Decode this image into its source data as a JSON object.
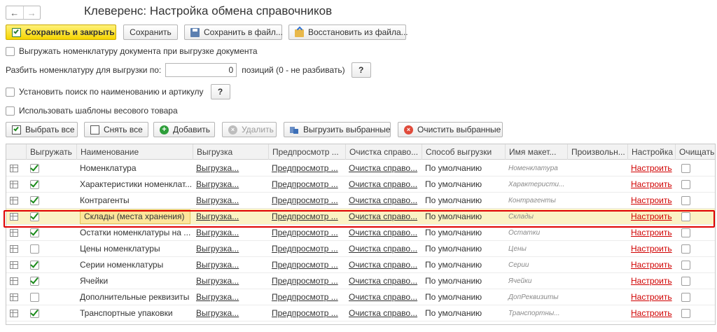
{
  "window": {
    "title": "Клеверенс: Настройка обмена справочников",
    "back_icon": "←",
    "forward_icon": "→"
  },
  "toolbar": {
    "save_close": "Сохранить и закрыть",
    "save": "Сохранить",
    "save_file": "Сохранить в файл...",
    "restore_file": "Восстановить из файла..."
  },
  "options": {
    "export_nomenclature": "Выгружать номенклатуру документа при выгрузке документа",
    "split_label": "Разбить номенклатуру для выгрузки по:",
    "split_value": "0",
    "split_suffix": "позиций (0 - не разбивать)",
    "help": "?",
    "search_setting": "Установить поиск по наименованию и артикулу",
    "weight_templates": "Использовать шаблоны весового товара"
  },
  "actions": {
    "select_all": "Выбрать все",
    "unselect_all": "Снять все",
    "add": "Добавить",
    "delete": "Удалить",
    "export_selected": "Выгрузить выбранные",
    "clear_selected": "Очистить выбранные"
  },
  "table": {
    "headers": [
      "Выгружать",
      "Наименование",
      "Выгрузка",
      "Предпросмотр ...",
      "Очистка справо...",
      "Способ выгрузки",
      "Имя макет...",
      "Произвольн...",
      "Настройка",
      "Очищать"
    ],
    "rows": [
      {
        "checked": true,
        "name": "Номенклатура",
        "export": "Выгрузка...",
        "preview": "Предпросмотр ...",
        "clear": "Очистка справо...",
        "method": "По умолчанию",
        "template": "Номенклатура",
        "setting": "Настроить"
      },
      {
        "checked": true,
        "name": "Характеристики номенклат...",
        "export": "Выгрузка...",
        "preview": "Предпросмотр ...",
        "clear": "Очистка справо...",
        "method": "По умолчанию",
        "template": "Характеристи...",
        "setting": "Настроить"
      },
      {
        "checked": true,
        "name": "Контрагенты",
        "export": "Выгрузка...",
        "preview": "Предпросмотр ...",
        "clear": "Очистка справо...",
        "method": "По умолчанию",
        "template": "Контрагенты",
        "setting": "Настроить"
      },
      {
        "checked": true,
        "name": "Склады (места хранения)",
        "export": "Выгрузка...",
        "preview": "Предпросмотр ...",
        "clear": "Очистка справо...",
        "method": "По умолчанию",
        "template": "Склады",
        "setting": "Настроить"
      },
      {
        "checked": true,
        "name": "Остатки номенклатуры на ...",
        "export": "Выгрузка...",
        "preview": "Предпросмотр ...",
        "clear": "Очистка справо...",
        "method": "По умолчанию",
        "template": "Остатки",
        "setting": "Настроить"
      },
      {
        "checked": false,
        "name": "Цены номенклатуры",
        "export": "Выгрузка...",
        "preview": "Предпросмотр ...",
        "clear": "Очистка справо...",
        "method": "По умолчанию",
        "template": "Цены",
        "setting": "Настроить"
      },
      {
        "checked": true,
        "name": "Серии номенклатуры",
        "export": "Выгрузка...",
        "preview": "Предпросмотр ...",
        "clear": "Очистка справо...",
        "method": "По умолчанию",
        "template": "Серии",
        "setting": "Настроить"
      },
      {
        "checked": true,
        "name": "Ячейки",
        "export": "Выгрузка...",
        "preview": "Предпросмотр ...",
        "clear": "Очистка справо...",
        "method": "По умолчанию",
        "template": "Ячейки",
        "setting": "Настроить"
      },
      {
        "checked": false,
        "name": "Дополнительные реквизиты",
        "export": "Выгрузка...",
        "preview": "Предпросмотр ...",
        "clear": "Очистка справо...",
        "method": "По умолчанию",
        "template": "ДопРеквизиты",
        "setting": "Настроить"
      },
      {
        "checked": true,
        "name": "Транспортные упаковки",
        "export": "Выгрузка...",
        "preview": "Предпросмотр ...",
        "clear": "Очистка справо...",
        "method": "По умолчанию",
        "template": "Транспортны...",
        "setting": "Настроить"
      }
    ]
  },
  "colors": {
    "primary": "#f6d500",
    "selected_row": "#fbf2c4",
    "highlight": "#e00000",
    "link_red": "#d00000",
    "check_green": "#1a8a1a"
  }
}
